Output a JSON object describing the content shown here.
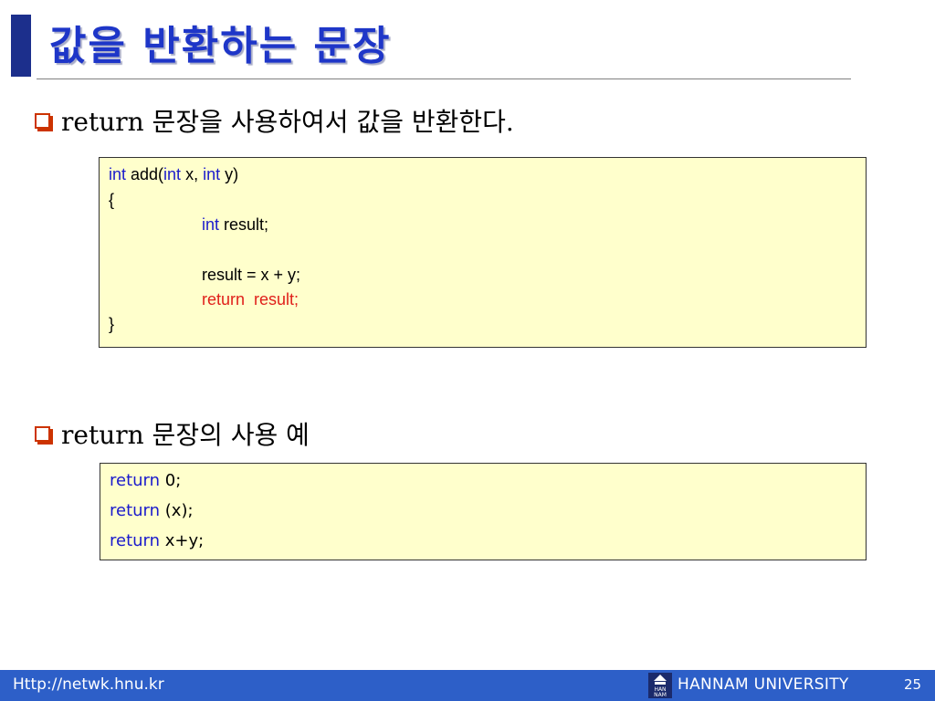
{
  "title": "값을 반환하는 문장",
  "bullets": [
    {
      "text": "return 문장을 사용하여서 값을 반환한다."
    },
    {
      "text": "return 문장의 사용 예"
    }
  ],
  "code1": {
    "l1": {
      "a": "int",
      "b": " add(",
      "c": "int",
      "d": " x, ",
      "e": "int",
      "f": " y)"
    },
    "l2": "{",
    "l3": {
      "a": "int",
      "b": " result;"
    },
    "l5": "result = x + y;",
    "l6": {
      "a": "return",
      "b": "  result;"
    },
    "l7": "}"
  },
  "code2": {
    "l1": {
      "a": "return",
      "b": " 0;"
    },
    "l2": {
      "a": "return",
      "b": " (x);"
    },
    "l3": {
      "a": "return",
      "b": " x+y;"
    }
  },
  "footer": {
    "url": "Http://netwk.hnu.kr",
    "logo_text": "HAN NAM",
    "university": "HANNAM UNIVERSITY",
    "page": "25"
  },
  "colors": {
    "title": "#1e36c8",
    "keyword_blue": "#1a1acc",
    "keyword_red": "#e0201a",
    "code_bg": "#ffffcc",
    "footer_bg": "#2d5fc8",
    "bullet_icon": "#cc3300"
  },
  "icons": {
    "bullet": "square-bullet-icon",
    "logo": "hannam-logo-icon"
  }
}
